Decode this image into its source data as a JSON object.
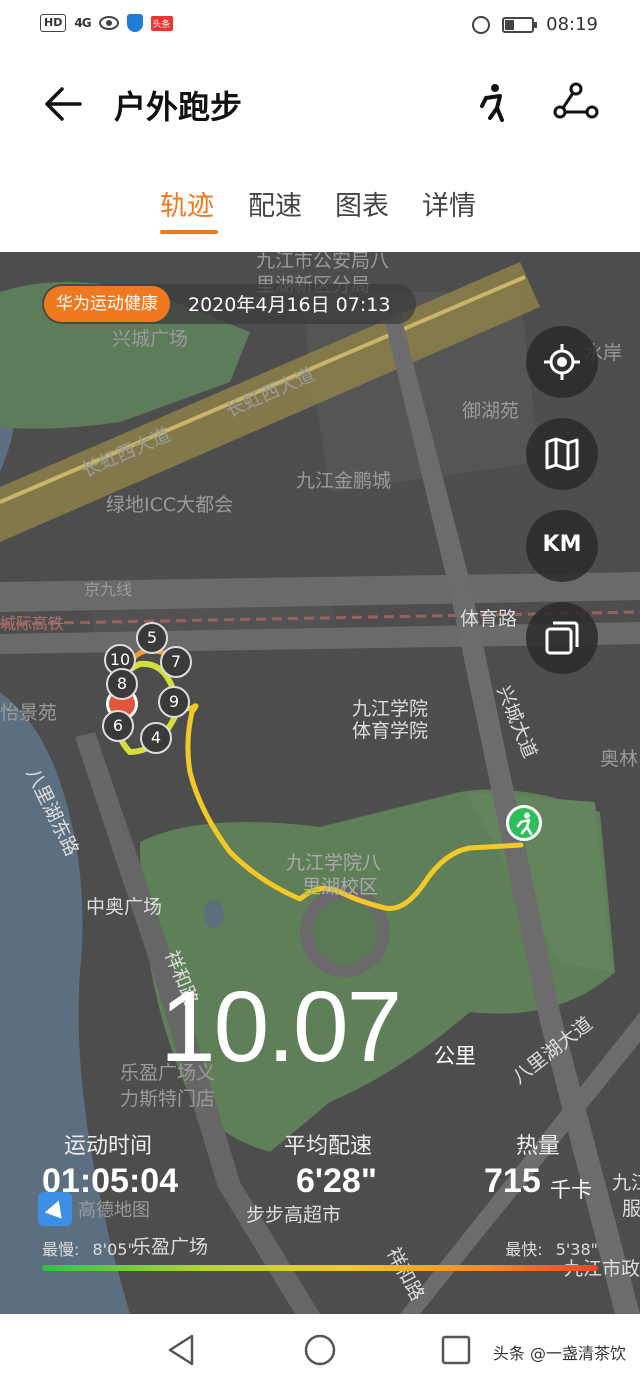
{
  "status_bar": {
    "hd": "HD",
    "network": "4G",
    "time": "08:19"
  },
  "header": {
    "title": "户外跑步"
  },
  "tabs": [
    {
      "label": "轨迹",
      "active": true
    },
    {
      "label": "配速",
      "active": false
    },
    {
      "label": "图表",
      "active": false
    },
    {
      "label": "详情",
      "active": false
    }
  ],
  "map": {
    "brand_tag": "华为运动健康",
    "datetime": "2020年4月16日 07:13",
    "km_button": "KM",
    "labels": [
      "九江市公安局八",
      "里湖新区分局",
      "兴城广场",
      "长虹西大道",
      "长虹西大道",
      "御湖苑",
      "水岸",
      "九江金鹏城",
      "绿地ICC大都会",
      "京九线",
      "城际高铁",
      "体育路",
      "怡景苑",
      "九江学院",
      "体育学院",
      "兴城大道",
      "奥林",
      "八里湖东路",
      "九江学院八",
      "里湖校区",
      "中奥广场",
      "祥和路",
      "八里湖大道",
      "乐盈广场义",
      "力斯特门店",
      "步步高超市",
      "乐盈广场",
      "九江",
      "服",
      "九江市政",
      "祥和路"
    ],
    "km_markers": [
      "5",
      "10",
      "7",
      "8",
      "9",
      "6",
      "4"
    ],
    "attribution": "高德地图"
  },
  "summary": {
    "distance": "10.07",
    "distance_unit": "公里",
    "duration_label": "运动时间",
    "duration_value": "01:05:04",
    "pace_label": "平均配速",
    "pace_value": "6'28\"",
    "calories_label": "热量",
    "calories_value": "715",
    "calories_unit": "千卡",
    "slowest_label": "最慢:",
    "slowest_value": "8'05\"",
    "fastest_label": "最快:",
    "fastest_value": "5'38\""
  },
  "watermark": "头条 @一盏清茶饮",
  "colors": {
    "accent": "#f0781e",
    "route": "#f3c928",
    "finish": "#2dbe5a",
    "start": "#e2553a"
  }
}
